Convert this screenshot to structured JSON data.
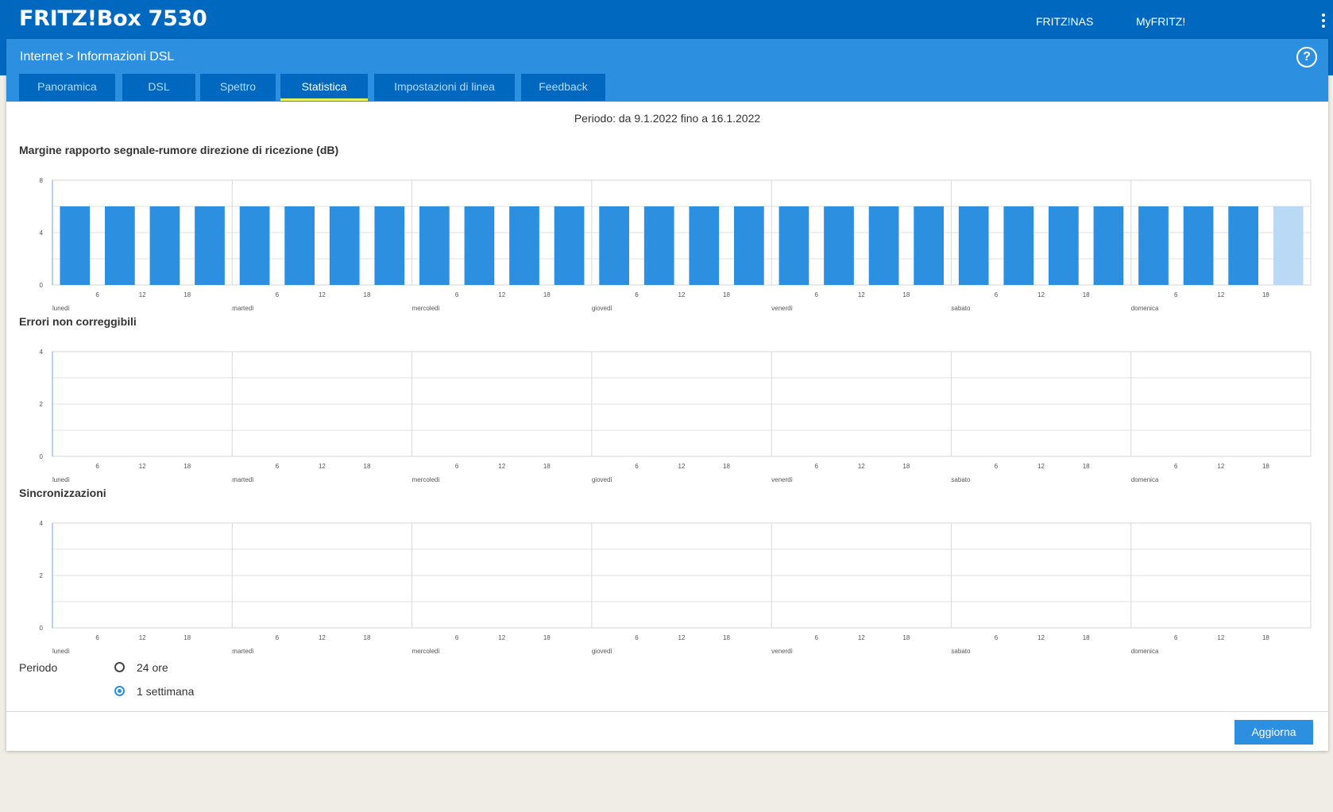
{
  "header": {
    "brand": "FRITZ!Box 7530",
    "links": [
      "FRITZ!NAS",
      "MyFRITZ!"
    ]
  },
  "breadcrumb": {
    "section": "Internet",
    "separator": ">",
    "page": "Informazioni DSL"
  },
  "tabs": [
    {
      "label": "Panoramica",
      "active": false
    },
    {
      "label": "DSL",
      "active": false
    },
    {
      "label": "Spettro",
      "active": false
    },
    {
      "label": "Statistica",
      "active": true
    },
    {
      "label": "Impostazioni di linea",
      "active": false
    },
    {
      "label": "Feedback",
      "active": false
    }
  ],
  "period_text": "Periodo: da 9.1.2022 fino a 16.1.2022",
  "colors": {
    "accent": "#2c8fdf",
    "dark_blue": "#0069bf",
    "bar_light": "#b9d9f5",
    "tab_underline": "#e4f35b"
  },
  "chart_data": [
    {
      "type": "bar",
      "title": "Margine rapporto segnale-rumore direzione di ricezione (dB)",
      "ylim": [
        0,
        8
      ],
      "yticks": [
        0,
        4,
        8
      ],
      "days": [
        "lunedì",
        "martedì",
        "mercoledì",
        "giovedì",
        "venerdì",
        "sabato",
        "domenica"
      ],
      "hour_ticks": [
        6,
        12,
        18
      ],
      "bar_hours": [
        3,
        9,
        15,
        21
      ],
      "values": [
        6,
        6,
        6,
        6,
        6,
        6,
        6,
        6,
        6,
        6,
        6,
        6,
        6,
        6,
        6,
        6,
        6,
        6,
        6,
        6,
        6,
        6,
        6,
        6,
        6,
        6,
        6,
        6
      ],
      "last_bar_partial": true
    },
    {
      "type": "bar",
      "title": "Errori non correggibili",
      "ylim": [
        0,
        4
      ],
      "yticks": [
        0,
        2,
        4
      ],
      "days": [
        "lunedì",
        "martedì",
        "mercoledì",
        "giovedì",
        "venerdì",
        "sabato",
        "domenica"
      ],
      "hour_ticks": [
        6,
        12,
        18
      ],
      "values": []
    },
    {
      "type": "bar",
      "title": "Sincronizzazioni",
      "ylim": [
        0,
        4
      ],
      "yticks": [
        0,
        2,
        4
      ],
      "days": [
        "lunedì",
        "martedì",
        "mercoledì",
        "giovedì",
        "venerdì",
        "sabato",
        "domenica"
      ],
      "hour_ticks": [
        6,
        12,
        18
      ],
      "values": []
    }
  ],
  "period_options": {
    "label": "Periodo",
    "options": [
      {
        "label": "24 ore",
        "selected": false
      },
      {
        "label": "1 settimana",
        "selected": true
      }
    ]
  },
  "button": {
    "label": "Aggiorna"
  }
}
